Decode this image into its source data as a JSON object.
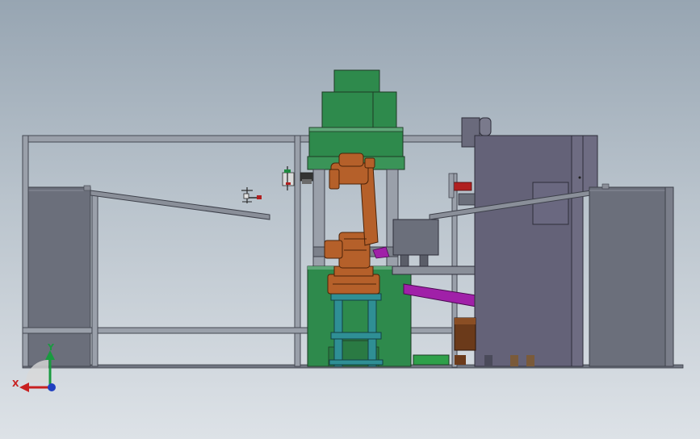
{
  "viewport": {
    "background_top": "#97a5b2",
    "background_bottom": "#dde2e7"
  },
  "model": {
    "frame_color": "#5f6470",
    "panel_color": "#6b6f7b",
    "press_color": "#2e7d44",
    "robot_color": "#b5602a",
    "stand_color": "#2f8f95",
    "pipe_color": "#a020a8",
    "machine_color": "#646278"
  },
  "triad": {
    "x_label": "X",
    "y_label": "Y",
    "x_color": "#c82020",
    "y_color": "#1a9a40",
    "z_color": "#2040c0",
    "icon": "coordinate-triad-icon"
  }
}
